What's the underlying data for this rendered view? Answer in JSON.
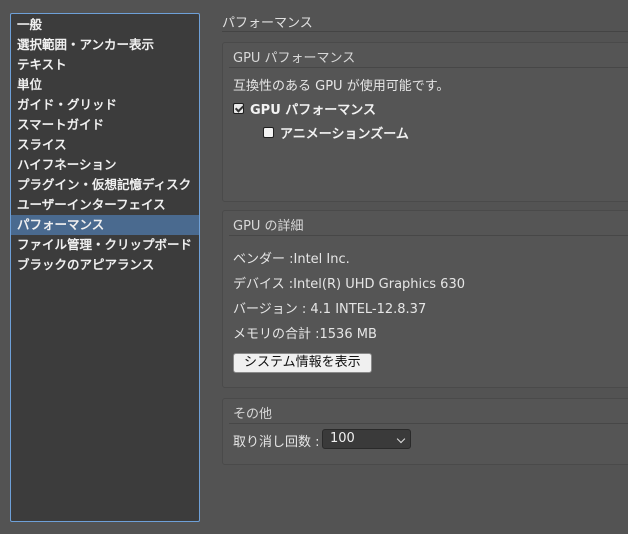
{
  "sidebar": {
    "items": [
      {
        "label": "一般"
      },
      {
        "label": "選択範囲・アンカー表示"
      },
      {
        "label": "テキスト"
      },
      {
        "label": "単位"
      },
      {
        "label": "ガイド・グリッド"
      },
      {
        "label": "スマートガイド"
      },
      {
        "label": "スライス"
      },
      {
        "label": "ハイフネーション"
      },
      {
        "label": "プラグイン・仮想記憶ディスク"
      },
      {
        "label": "ユーザーインターフェイス"
      },
      {
        "label": "パフォーマンス"
      },
      {
        "label": "ファイル管理・クリップボード"
      },
      {
        "label": "ブラックのアピアランス"
      }
    ],
    "selected_index": 10
  },
  "main": {
    "title": "パフォーマンス",
    "gpu_performance": {
      "title": "GPU パフォーマンス",
      "status_text": "互換性のある GPU が使用可能です。",
      "gpu_checkbox_label": "GPU パフォーマンス",
      "animation_zoom_label": "アニメーションズーム"
    },
    "gpu_details": {
      "title": "GPU の詳細",
      "vendor": "ベンダー :Intel Inc.",
      "device": "デバイス :Intel(R) UHD Graphics 630",
      "version": "バージョン : 4.1 INTEL-12.8.37",
      "memory": "メモリの合計 :1536 MB",
      "system_info_button": "システム情報を表示"
    },
    "other": {
      "title": "その他",
      "undo_label": "取り消し回数 :",
      "undo_value": "100"
    }
  }
}
